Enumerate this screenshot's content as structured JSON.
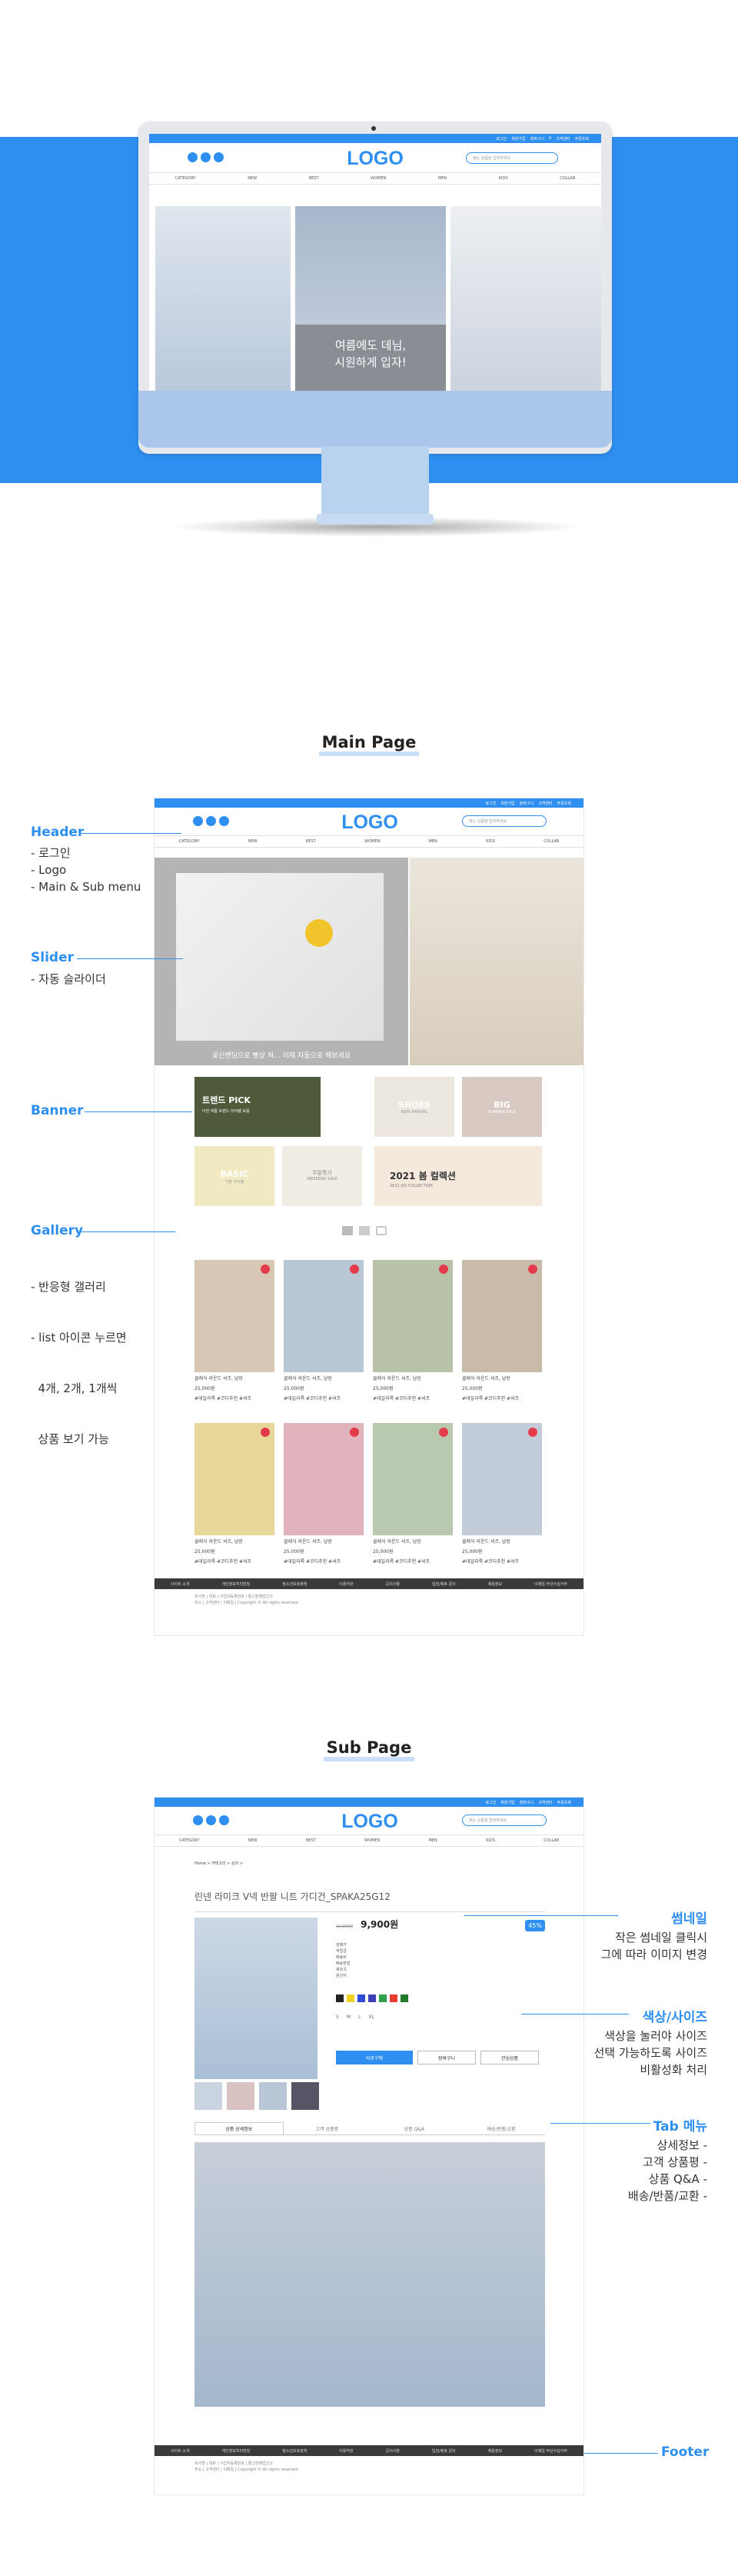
{
  "hero": {
    "logo": "LOGO",
    "search_placeholder": "찾는 상품을 입력하세요",
    "top_links": [
      "로그인",
      "회원가입",
      "장바구니",
      "0",
      "고객센터",
      "주문조회"
    ],
    "nav": [
      "CATEGORY",
      "NEW",
      "BEST",
      "WOMEN",
      "MEN",
      "KIDS",
      "COLLAB"
    ],
    "banner_text_line1": "여름에도 데님,",
    "banner_text_line2": "시원하게 입자!"
  },
  "main_page": {
    "title": "Main Page",
    "annotations": {
      "header": {
        "label": "Header",
        "items": [
          "- 로그인",
          "- Logo",
          "- Main & Sub menu"
        ]
      },
      "slider": {
        "label": "Slider",
        "items": [
          "- 자동 슬라이더"
        ]
      },
      "banner": {
        "label": "Banner"
      },
      "gallery": {
        "label": "Gallery",
        "items": [
          "- 반응형 갤러리",
          "- list 아이콘 누르면",
          "  4개, 2개, 1개씩",
          "  상품 보기 가능"
        ]
      }
    },
    "slider_caption": "꽃신벤딩으로 빵상 쳐... 이제 자동으로 해보세요",
    "banners": [
      {
        "title": "트렌드 PICK",
        "sub": "이번 여름 트렌드 아이템 모음"
      },
      {
        "title": "SHOES",
        "sub": "NEW ARRIVAL"
      },
      {
        "title": "BIG",
        "sub": "SUMMER SALE"
      },
      {
        "title": "BASIC",
        "sub": "기본 아이템"
      },
      {
        "title": "주말특가",
        "sub": "WEEKEND SALE"
      },
      {
        "title": "2021 봄 컬렉션",
        "sub": "2021 S/S COLLECTION"
      }
    ],
    "products": [
      {
        "name": "클래식 라운드 셔츠, 남방",
        "price": "25,000원",
        "tags": "#데일리룩 #코디추천 #셔츠"
      },
      {
        "name": "클래식 라운드 셔츠, 남방",
        "price": "25,000원",
        "tags": "#데일리룩 #코디추천 #셔츠"
      },
      {
        "name": "클래식 라운드 셔츠, 남방",
        "price": "25,000원",
        "tags": "#데일리룩 #코디추천 #셔츠"
      },
      {
        "name": "클래식 라운드 셔츠, 남방",
        "price": "25,000원",
        "tags": "#데일리룩 #코디추천 #셔츠"
      },
      {
        "name": "클래식 라운드 셔츠, 남방",
        "price": "25,000원",
        "tags": "#데일리룩 #코디추천 #셔츠"
      },
      {
        "name": "클래식 라운드 셔츠, 남방",
        "price": "25,000원",
        "tags": "#데일리룩 #코디추천 #셔츠"
      },
      {
        "name": "클래식 라운드 셔츠, 남방",
        "price": "25,000원",
        "tags": "#데일리룩 #코디추천 #셔츠"
      },
      {
        "name": "클래식 라운드 셔츠, 남방",
        "price": "25,000원",
        "tags": "#데일리룩 #코디추천 #셔츠"
      }
    ],
    "footer_links": [
      "사이트 소개",
      "개인정보처리방침",
      "청소년보호정책",
      "이용약관",
      "공지사항",
      "입점/제휴 문의",
      "채용정보",
      "이메일 무단수집거부"
    ],
    "footer_info": [
      "회사명 | 대표 | 사업자등록번호 | 통신판매업신고",
      "주소 | 고객센터 | 이메일 | Copyright © All rights reserved."
    ]
  },
  "sub_page": {
    "title": "Sub Page",
    "product_title": "린넨 라미크 V넥 반팔 니트 가디건_SPAKA25G12",
    "breadcrumb": "Home > 카테고리 > 상의 >",
    "price_original": "12,000원",
    "price": "9,900원",
    "discount": "45%",
    "info_rows": [
      "판매가",
      "적립금",
      "배송비",
      "배송방법",
      "제조국",
      "원산지"
    ],
    "colors": [
      "#222222",
      "#f2d024",
      "#2f4bd8",
      "#3f3fb8",
      "#2ea04a",
      "#e63b2e",
      "#1f7a2a"
    ],
    "sizes": [
      "S",
      "M",
      "L",
      "XL"
    ],
    "buttons": [
      "바로구매",
      "장바구니",
      "관심상품"
    ],
    "tabs": [
      "상품 상세정보",
      "고객 상품평",
      "상품 Q&A",
      "배송/반품/교환"
    ],
    "annotations": {
      "thumbnail": {
        "label": "썸네일",
        "items": [
          "작은 썸네일 클릭시",
          "그에 따라 이미지 변경"
        ]
      },
      "color_size": {
        "label": "색상/사이즈",
        "items": [
          "색상을 눌러야 사이즈",
          "선택 가능하도록 사이즈",
          "비활성화 처리"
        ]
      },
      "tab_menu": {
        "label": "Tab 메뉴",
        "items": [
          "상세정보 -",
          "고객 상품평 -",
          "상품 Q&A -",
          "배송/반품/교환 -"
        ]
      },
      "footer": {
        "label": "Footer"
      }
    }
  }
}
